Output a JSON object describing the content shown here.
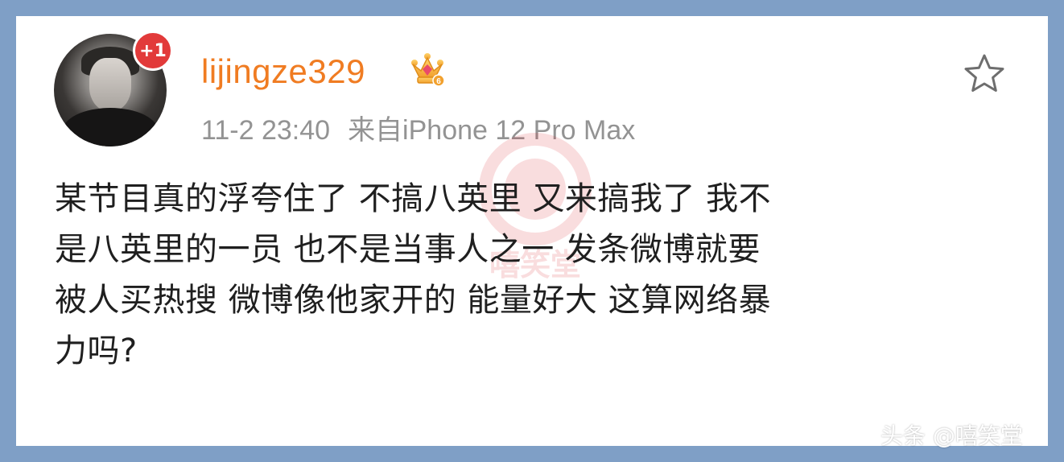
{
  "post": {
    "avatar_badge": "+1",
    "username": "lijingze329",
    "vip_level": "6",
    "timestamp": "11-2 23:40",
    "source": "来自iPhone 12 Pro Max",
    "content_lines": [
      "某节目真的浮夸住了 不搞八英里 又来搞我了 我不",
      "是八英里的一员 也不是当事人之一  发条微博就要",
      "被人买热搜 微博像他家开的 能量好大 这算网络暴",
      "力吗?"
    ]
  },
  "watermark": {
    "center_text": "嘻笑堂",
    "footer_text": "头条 @嘻笑堂"
  },
  "colors": {
    "frame": "#7f9fc6",
    "username": "#f07c22",
    "badge": "#e23a3a",
    "meta": "#939393",
    "text": "#1f1f1f"
  },
  "icons": {
    "favorite": "star-outline-icon",
    "vip": "crown-icon"
  }
}
